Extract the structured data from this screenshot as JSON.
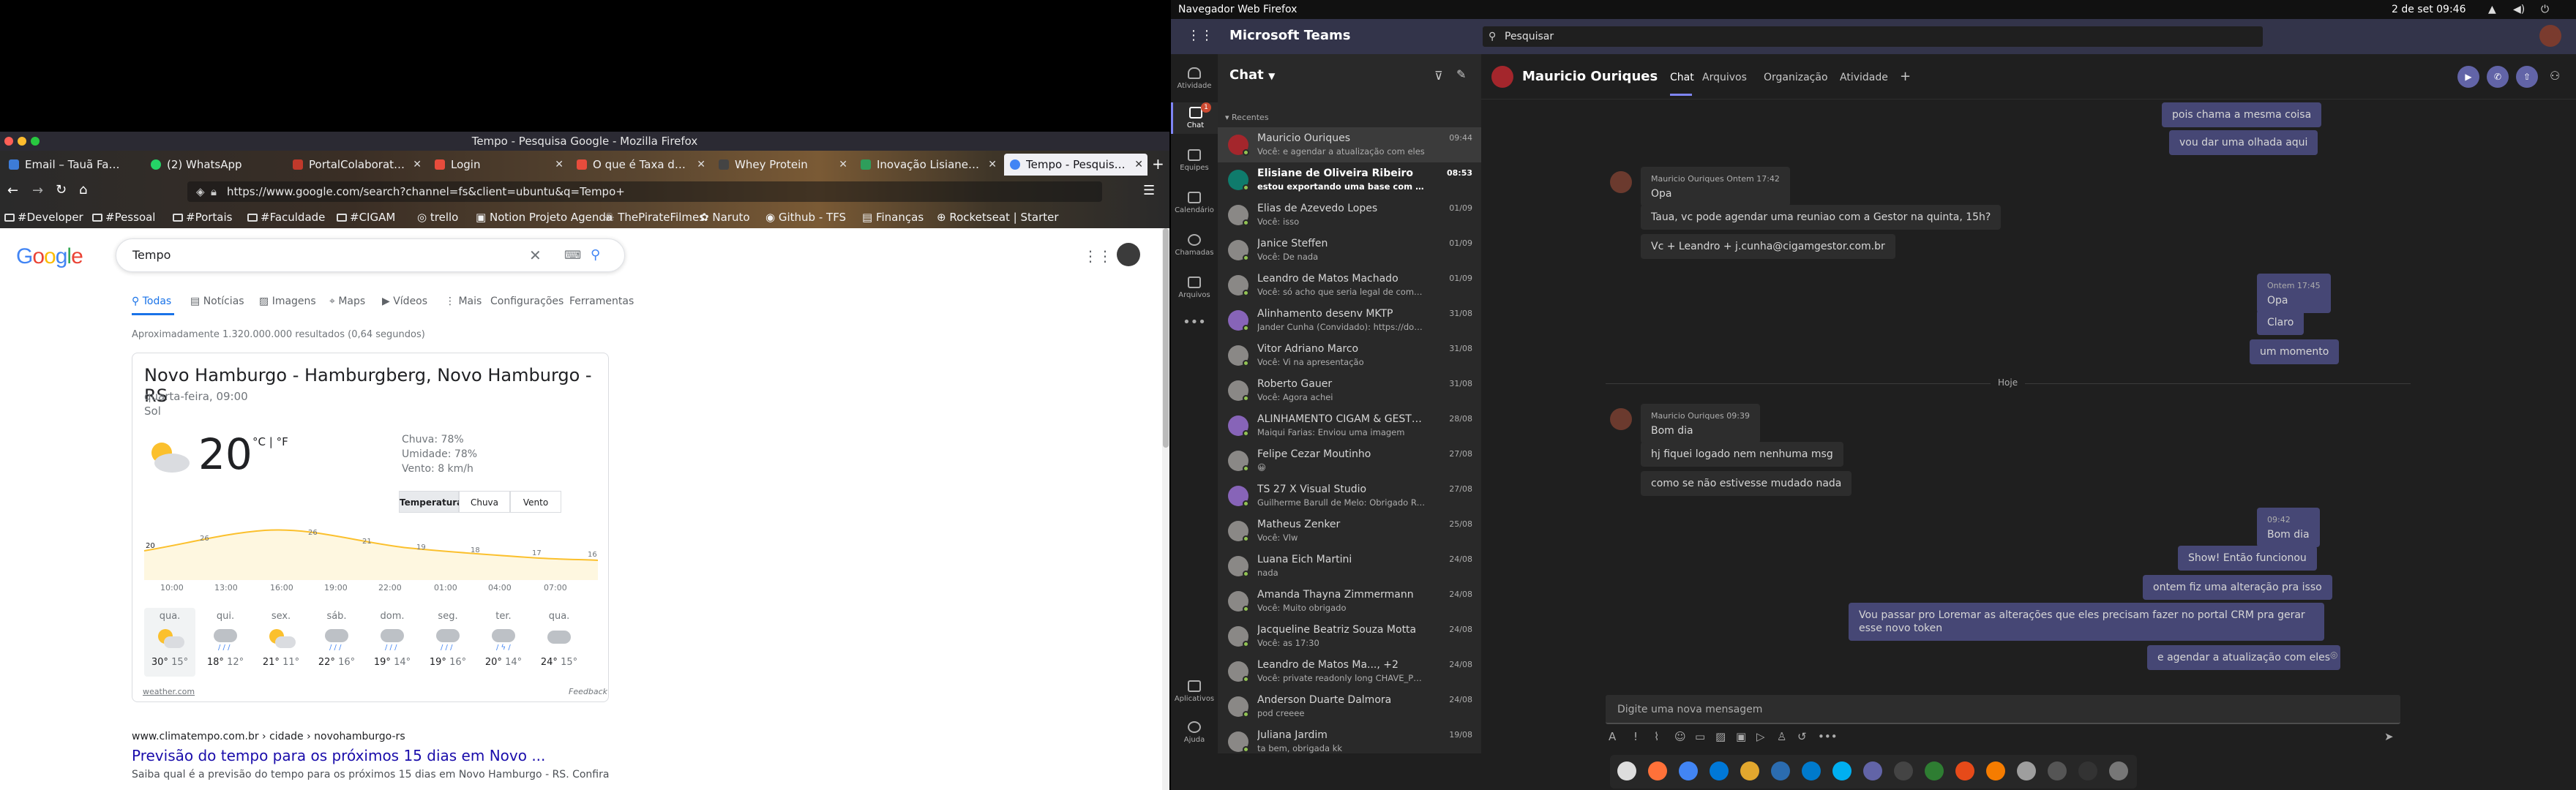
{
  "firefox": {
    "window_title": "Tempo - Pesquisa Google - Mozilla Firefox",
    "tabs": [
      {
        "label": "Email – Tauã Fagun",
        "color": "#3d7cd8"
      },
      {
        "label": "(2) WhatsApp",
        "color": "#25d366"
      },
      {
        "label": "PortalColaborativo",
        "color": "#c0392b"
      },
      {
        "label": "Login",
        "color": "#e74c3c"
      },
      {
        "label": "O que é Taxa de Co",
        "color": "#e74c3c"
      },
      {
        "label": "Whey Protein",
        "color": "#444444"
      },
      {
        "label": "Inovação Lisiane - P",
        "color": "#2e9e5b"
      },
      {
        "label": "Tempo - Pesquisa G",
        "color": "#4285f4"
      }
    ],
    "url": "https://www.google.com/search?channel=fs&client=ubuntu&q=Tempo+",
    "bookmarks": [
      "#Developer",
      "#Pessoal",
      "#Portais",
      "#Faculdade",
      "#CIGAM",
      "trello",
      "Notion Projeto Agenda",
      "ThePirateFilmes",
      "Naruto",
      "Github - TFS",
      "Finanças",
      "Rocketseat | Starter"
    ]
  },
  "google": {
    "query": "Tempo",
    "tabs": [
      "Todas",
      "Notícias",
      "Imagens",
      "Maps",
      "Vídeos",
      "Mais",
      "Configurações",
      "Ferramentas"
    ],
    "stats": "Aproximadamente 1.320.000.000 resultados (0,64 segundos)",
    "weather": {
      "location": "Novo Hamburgo - Hamburgberg, Novo Hamburgo - RS",
      "day": "quarta-feira, 09:00",
      "condition": "Sol",
      "temp": "20",
      "units": "°C | °F",
      "rain": "Chuva: 78%",
      "humidity": "Umidade: 78%",
      "wind": "Vento: 8 km/h",
      "chips": [
        "Temperatura",
        "Chuva",
        "Vento"
      ],
      "hourly_labels": [
        "20",
        "26",
        "30",
        "26",
        "21",
        "19",
        "18",
        "17",
        "16"
      ],
      "hours": [
        "10:00",
        "13:00",
        "16:00",
        "19:00",
        "22:00",
        "01:00",
        "04:00",
        "07:00"
      ],
      "days": [
        {
          "d": "qua.",
          "hi": "30°",
          "lo": "15°"
        },
        {
          "d": "qui.",
          "hi": "18°",
          "lo": "12°"
        },
        {
          "d": "sex.",
          "hi": "21°",
          "lo": "11°"
        },
        {
          "d": "sáb.",
          "hi": "22°",
          "lo": "16°"
        },
        {
          "d": "dom.",
          "hi": "19°",
          "lo": "14°"
        },
        {
          "d": "seg.",
          "hi": "19°",
          "lo": "16°"
        },
        {
          "d": "ter.",
          "hi": "20°",
          "lo": "14°"
        },
        {
          "d": "qua.",
          "hi": "24°",
          "lo": "15°"
        }
      ],
      "source": "weather.com",
      "feedback": "Feedback"
    },
    "result1": {
      "crumb": "www.climatempo.com.br › cidade › novohamburgo-rs",
      "title": "Previsão do tempo para os próximos 15 dias em Novo ...",
      "snippet": "Saiba qual é a previsão do tempo para os próximos 15 dias em Novo Hamburgo - RS. Confira"
    }
  },
  "system": {
    "app": "Navegador Web Firefox",
    "clock": "2 de set  09:46"
  },
  "teams": {
    "app_title": "Microsoft Teams",
    "search_placeholder": "Pesquisar",
    "rail": [
      "Atividade",
      "Chat",
      "Equipes",
      "Calendário",
      "Chamadas",
      "Arquivos",
      "Aplicativos",
      "Ajuda"
    ],
    "chat_badge": "1",
    "chat_title": "Chat",
    "recent_label": "Recentes",
    "chats": [
      {
        "name": "Mauricio Ouriques",
        "preview": "Você: e agendar a atualização com eles",
        "date": "09:44",
        "color": "#a4262c"
      },
      {
        "name": "Elisiane de Oliveira Ribeiro",
        "preview": "estou exportando uma base com e-mails de ...",
        "date": "08:53",
        "color": "#0f7b6c"
      },
      {
        "name": "Elias de Azevedo Lopes",
        "preview": "Você: isso",
        "date": "01/09",
        "color": "#8a8886"
      },
      {
        "name": "Janice Steffen",
        "preview": "Você: De nada",
        "date": "01/09",
        "color": "#8a8886"
      },
      {
        "name": "Leandro de Matos Machado",
        "preview": "Você: só acho que seria legal de comentar sobre...",
        "date": "01/09",
        "color": "#8a8886"
      },
      {
        "name": "Alinhamento desenv MKTP",
        "preview": "Jander Cunha (Convidado): https://docs.google.c...",
        "date": "31/08",
        "color": "#8764b8"
      },
      {
        "name": "Vitor Adriano Marco",
        "preview": "Você: Vi na apresentação",
        "date": "31/08",
        "color": "#8a8886"
      },
      {
        "name": "Roberto Gauer",
        "preview": "Você: Agora achei",
        "date": "31/08",
        "color": "#8a8886"
      },
      {
        "name": "ALINHAMENTO CIGAM & GESTOR M...",
        "preview": "Maiqui Farias: Enviou uma imagem",
        "date": "28/08",
        "color": "#8764b8"
      },
      {
        "name": "Felipe Cezar Moutinho",
        "preview": "😀",
        "date": "27/08",
        "color": "#8a8886"
      },
      {
        "name": "TS 27 X Visual Studio",
        "preview": "Guilherme Barull de Melo: Obrigado Rafael",
        "date": "27/08",
        "color": "#8764b8"
      },
      {
        "name": "Matheus Zenker",
        "preview": "Você: Vlw",
        "date": "25/08",
        "color": "#8a8886"
      },
      {
        "name": "Luana Eich Martini",
        "preview": "nada",
        "date": "24/08",
        "color": "#8a8886"
      },
      {
        "name": "Amanda Thayna Zimmermann",
        "preview": "Você: Muito obrigado",
        "date": "24/08",
        "color": "#8a8886"
      },
      {
        "name": "Jacqueline Beatriz Souza Motta",
        "preview": "Você: as 17:30",
        "date": "24/08",
        "color": "#8a8886"
      },
      {
        "name": "Leandro de Matos Ma..., +2",
        "preview": "Você: private readonly long CHAVE_PESQUISA_...",
        "date": "24/08",
        "color": "#8a8886"
      },
      {
        "name": "Anderson Duarte Dalmora",
        "preview": "pod creeee",
        "date": "24/08",
        "color": "#8a8886"
      },
      {
        "name": "Juliana Jardim",
        "preview": "ta bem, obrigada kk",
        "date": "19/08",
        "color": "#8a8886"
      }
    ],
    "contact": "Mauricio Ouriques",
    "conv_tabs": [
      "Chat",
      "Arquivos",
      "Organização",
      "Atividade"
    ],
    "messages": {
      "m1": "pois chama a mesma coisa",
      "m2": "vou dar uma olhada aqui",
      "m3_meta": "Mauricio Ouriques   Ontem 17:42",
      "m3": "Opa",
      "m4": "Taua, vc pode agendar uma reuniao com a Gestor na quinta, 15h?",
      "m5": "Vc + Leandro + j.cunha@cigamgestor.com.br",
      "m6_meta": "Ontem 17:45",
      "m6": "Opa",
      "m7": "Claro",
      "m8": "um momento",
      "divider": "Hoje",
      "m9_meta": "Mauricio Ouriques   09:39",
      "m9": "Bom dia",
      "m10": "hj fiquei logado nem nenhuma msg",
      "m11": "como se não estivesse mudado nada",
      "m12_meta": "09:42",
      "m12": "Bom dia",
      "m13": "Show! Então funcionou",
      "m14": "ontem fiz uma alteração pra isso",
      "m15": "Vou passar pro Loremar as alterações que eles precisam fazer no portal CRM pra gerar esse novo token",
      "m16": "e agendar a atualização com eles"
    },
    "composer_placeholder": "Digite uma nova mensagem"
  }
}
